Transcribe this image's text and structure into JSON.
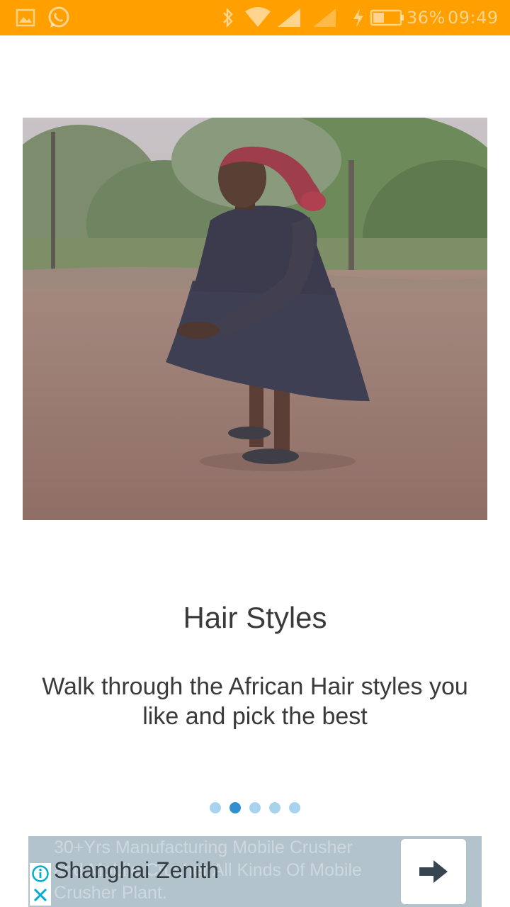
{
  "status_bar": {
    "battery": "36%",
    "time": "09:49",
    "background_color": "#ff9f00",
    "icons": [
      "image-icon",
      "whatsapp-icon",
      "bluetooth-icon",
      "wifi-icon",
      "signal-icon",
      "signal-icon",
      "charging-icon",
      "battery-icon"
    ]
  },
  "onboarding": {
    "image_description": "photo-of-woman-in-dark-dress",
    "title": "Hair Styles",
    "description": "Walk through the African Hair styles you like and pick the best",
    "page_indicator": {
      "total": 5,
      "active_index": 1,
      "active_color": "#2f8fd0",
      "inactive_color": "#a8d3ee"
    }
  },
  "ad": {
    "background_text": "30+Yrs Manufacturing Mobile Crusher and Mobile Crusher All Kinds Of Mobile Crusher Plant.",
    "title": "Shanghai Zenith",
    "info_icon": "info-icon",
    "close_icon": "close-icon",
    "cta_icon": "arrow-right-icon",
    "background_color": "#b2c3cc"
  }
}
